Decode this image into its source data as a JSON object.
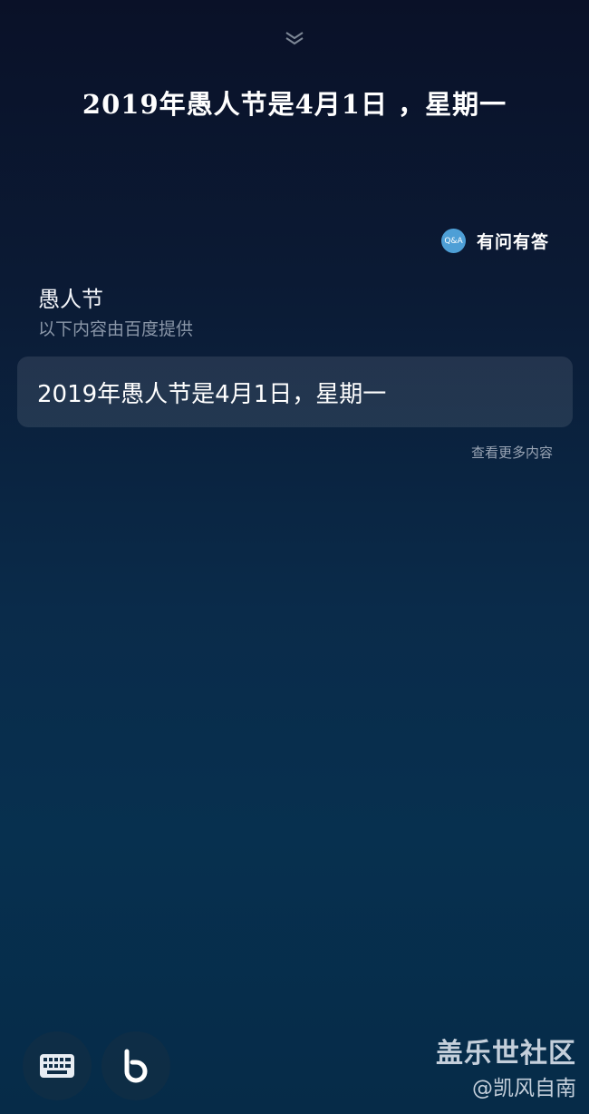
{
  "header": {
    "collapse_icon": "double-chevron-down-icon",
    "query_text": "2019年愚人节是4月1日 ，星期一"
  },
  "source": {
    "badge_text": "Q&A",
    "label": "有问有答"
  },
  "card": {
    "title": "愚人节",
    "subtitle": "以下内容由百度提供",
    "answer": "2019年愚人节是4月1日，星期一",
    "more_link": "查看更多内容"
  },
  "bottom_bar": {
    "keyboard_icon": "keyboard-icon",
    "bixby_icon": "bixby-icon"
  },
  "watermark": {
    "line1": "盖乐世社区",
    "line2": "@凯风自南"
  },
  "colors": {
    "accent": "#4e9fd6",
    "bg_top": "#0a1128",
    "bg_bottom": "#062b48"
  }
}
